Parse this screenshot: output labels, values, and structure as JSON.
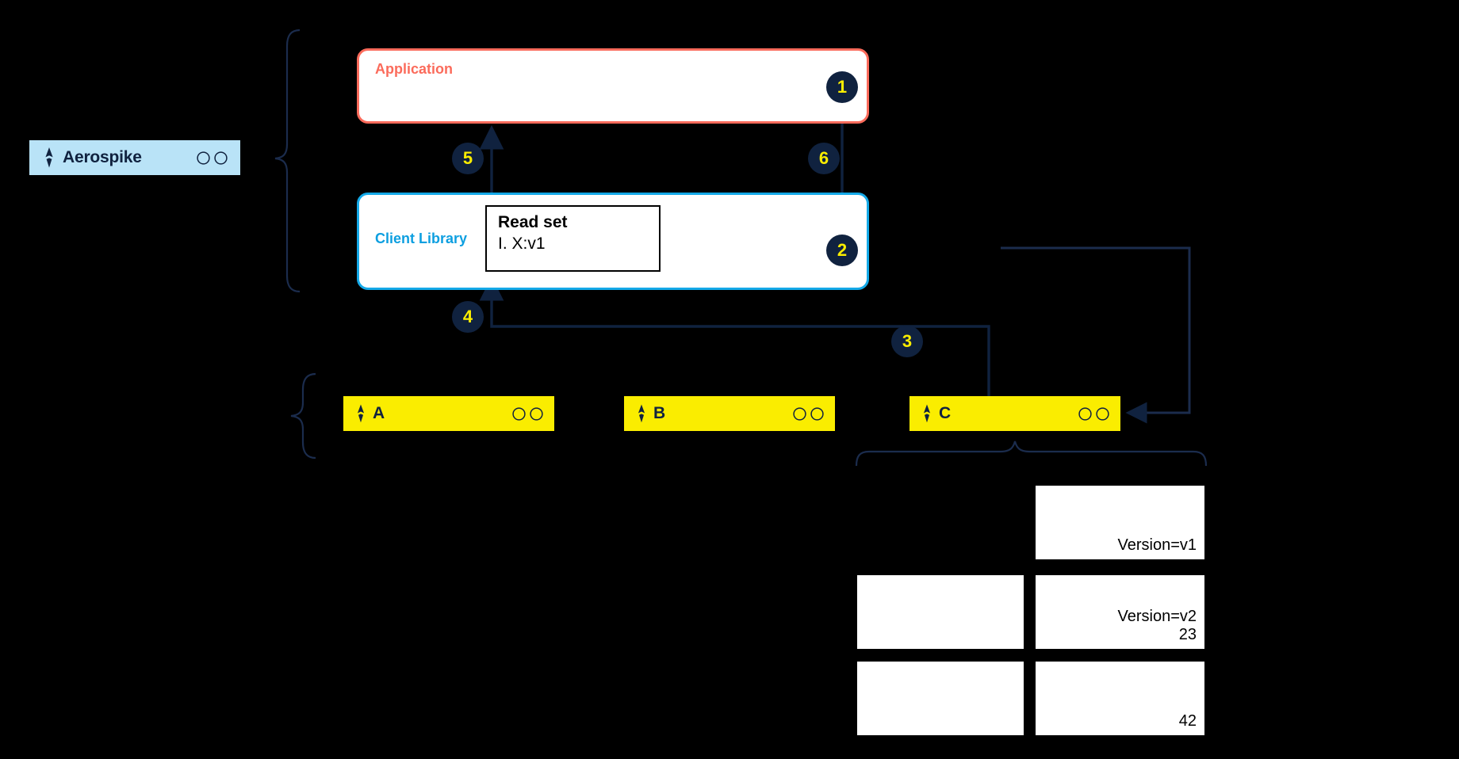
{
  "aerospike_pill": {
    "label": "Aerospike",
    "logo_icon": "aerospike-logo-icon",
    "dot_icons": [
      "circle-icon",
      "circle-icon"
    ],
    "bg_color": "#b9e3f7"
  },
  "boxes": {
    "application": {
      "label": "Application",
      "border_color": "#fb6b5b",
      "fill_color": "#ffffff"
    },
    "client_library": {
      "label": "Client Library",
      "border_color": "#14a9e8",
      "fill_color": "#ffffff"
    }
  },
  "read_set": {
    "title": "Read set",
    "items": [
      "I.  X:v1"
    ]
  },
  "nodes": [
    {
      "label": "A",
      "logo_icon": "aerospike-logo-icon",
      "dot_icons": [
        "circle-icon",
        "circle-icon"
      ]
    },
    {
      "label": "B",
      "logo_icon": "aerospike-logo-icon",
      "dot_icons": [
        "circle-icon",
        "circle-icon"
      ]
    },
    {
      "label": "C",
      "logo_icon": "aerospike-logo-icon",
      "dot_icons": [
        "circle-icon",
        "circle-icon"
      ]
    }
  ],
  "node_fill_color": "#faed00",
  "steps": [
    {
      "number": "1"
    },
    {
      "number": "2"
    },
    {
      "number": "3"
    },
    {
      "number": "4"
    },
    {
      "number": "5"
    },
    {
      "number": "6"
    }
  ],
  "badge_colors": {
    "fill": "#10223f",
    "text": "#faed00"
  },
  "version_table": {
    "rows": [
      {
        "left": "",
        "right": "Version=v1"
      },
      {
        "left": "",
        "right": "Version=v2\n23"
      },
      {
        "left": "",
        "right": "42"
      }
    ],
    "cells": {
      "r1c2": "Version=v1",
      "r2c1": "",
      "r2c2_line1": "Version=v2",
      "r2c2_line2": "23",
      "r3c1": "",
      "r3c2": "42"
    }
  },
  "line_color": "#10223f"
}
